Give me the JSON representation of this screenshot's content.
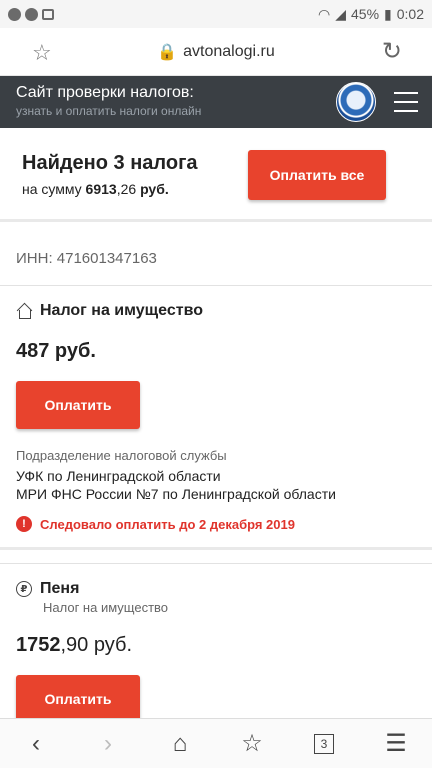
{
  "status_bar": {
    "battery": "45%",
    "time": "0:02"
  },
  "browser": {
    "url": "avtonalogi.ru"
  },
  "site_header": {
    "title": "Сайт проверки налогов:",
    "subtitle": "узнать и оплатить налоги онлайн"
  },
  "summary": {
    "found": "Найдено 3 налога",
    "total_prefix": "на сумму ",
    "total_int": "6913",
    "total_dec": ",26 ",
    "total_unit": "руб.",
    "pay_all_label": "Оплатить все"
  },
  "inn": "ИНН: 471601347163",
  "taxes": [
    {
      "title": "Налог на имущество",
      "amount_int": "487 руб.",
      "pay_label": "Оплатить",
      "dept_label": "Подразделение налоговой службы",
      "dept_line1": "УФК по Ленинградской области",
      "dept_line2": "МРИ ФНС России №7 по Ленинградской области",
      "due": "Следовало оплатить до 2 декабря 2019"
    },
    {
      "title": "Пеня",
      "subtitle": "Налог на имущество",
      "amount_int": "1752",
      "amount_dec": ",90 руб.",
      "pay_label": "Оплатить"
    }
  ],
  "bottom_nav": {
    "tabs_count": "3"
  },
  "colors": {
    "accent": "#e8432d",
    "header_bg": "#3a3f44",
    "warning": "#e0342c"
  }
}
